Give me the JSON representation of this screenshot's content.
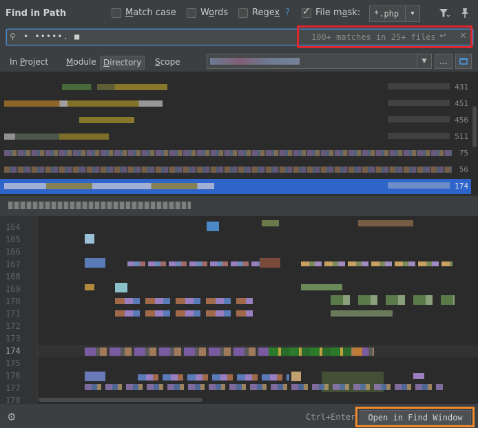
{
  "dialog": {
    "title": "Find in Path"
  },
  "options": {
    "match_case": {
      "label": "Match case",
      "checked": false
    },
    "words": {
      "label": "Words",
      "checked": false
    },
    "regex": {
      "label": "Regex",
      "help": "?",
      "checked": false
    },
    "file_mask": {
      "label": "File mask:",
      "checked": true,
      "value": "*.php"
    }
  },
  "search": {
    "query": "• •••••. ■",
    "matches_text": "100+ matches in 25+ files"
  },
  "scope": {
    "tabs": [
      "In Project",
      "Module",
      "Directory",
      "Scope"
    ],
    "selected_tab": "Directory",
    "browse_label": "..."
  },
  "results": {
    "line_numbers": [
      "431",
      "451",
      "456",
      "511",
      "75",
      "56",
      "174"
    ],
    "selected_line": "174"
  },
  "preview": {
    "line_numbers": [
      "164",
      "165",
      "166",
      "167",
      "168",
      "169",
      "170",
      "171",
      "172",
      "173",
      "174",
      "175",
      "176",
      "177",
      "178"
    ],
    "current_line": "174"
  },
  "footer": {
    "shortcut": "Ctrl+Enter",
    "open_button": "Open in Find Window"
  },
  "colors": {
    "accent": "#2f65ca",
    "search_border": "#4a88c7",
    "matches_highlight": "#e0262c",
    "button_highlight": "#f08a2c"
  }
}
